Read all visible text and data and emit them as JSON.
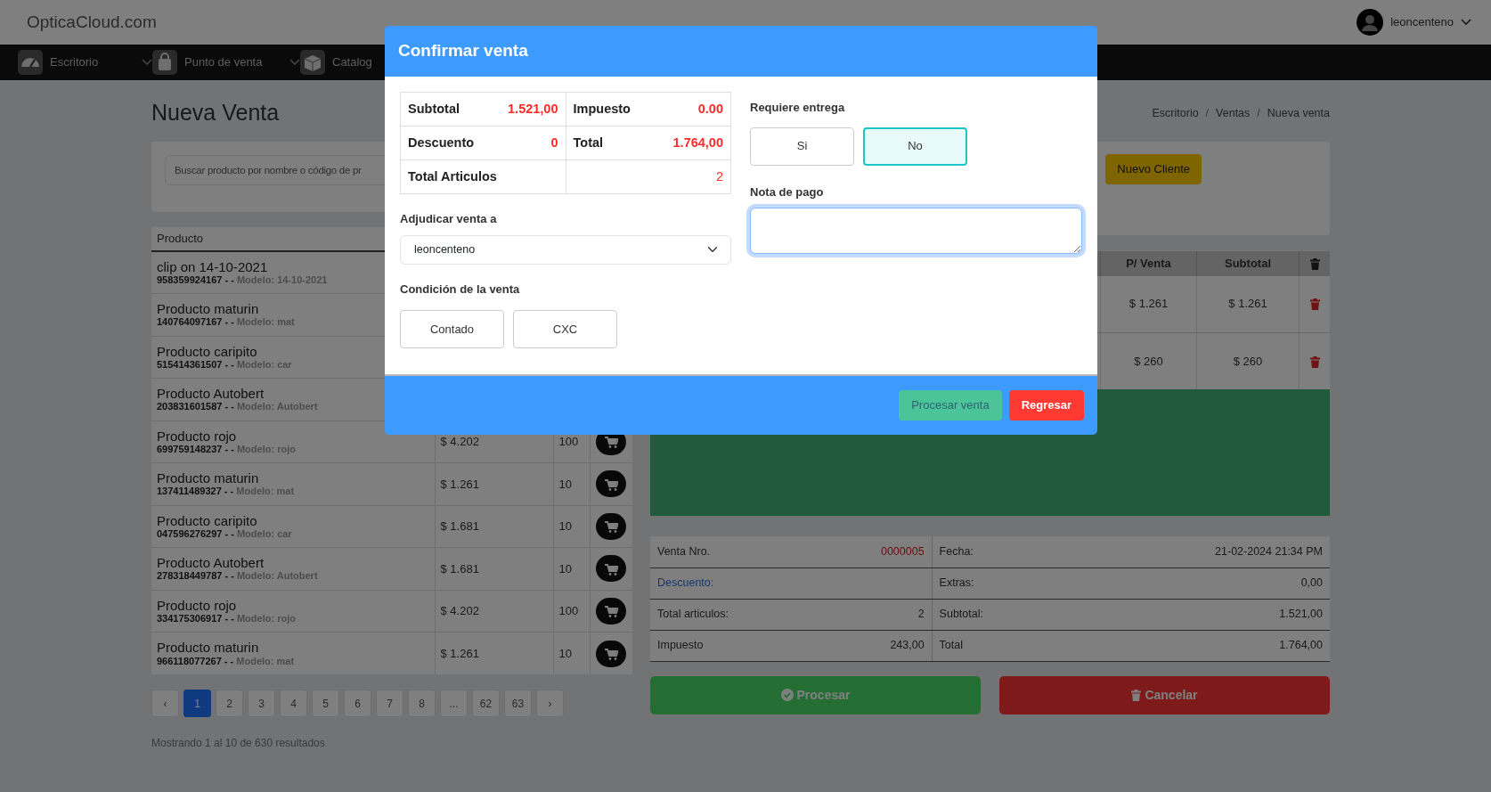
{
  "header": {
    "logo": "OpticaCloud.com",
    "user": "leoncenteno"
  },
  "nav": [
    {
      "label": "Escritorio",
      "dropdown": true
    },
    {
      "label": "Punto de venta",
      "dropdown": true
    },
    {
      "label": "Catalog",
      "dropdown": false
    }
  ],
  "page": {
    "title": "Nueva Venta",
    "breadcrumb": [
      {
        "label": "Escritorio",
        "separator": "/"
      },
      {
        "label": "Ventas",
        "separator": "/"
      },
      {
        "label": "Nueva venta"
      }
    ]
  },
  "search": {
    "placeholder": "Buscar producto por nombre o código de pr"
  },
  "new_client_button": "Nuevo Cliente",
  "products": {
    "columns": [
      "Producto"
    ],
    "rows": [
      {
        "name": "clip on 14-10-2021",
        "code": "958359924167 - -",
        "model": "Modelo: 14-10-2021"
      },
      {
        "name": "Producto maturin",
        "code": "140764097167 - -",
        "model": "Modelo: mat"
      },
      {
        "name": "Producto caripito",
        "code": "515414361507 - -",
        "model": "Modelo: car"
      },
      {
        "name": "Producto Autobert",
        "code": "203831601587 - -",
        "model": "Modelo: Autobert"
      },
      {
        "name": "Producto rojo",
        "code": "699759148237 - -",
        "model": "Modelo: rojo",
        "price": "$ 4.202",
        "stock": "100"
      },
      {
        "name": "Producto maturin",
        "code": "137411489327 - -",
        "model": "Modelo: mat",
        "price": "$ 1.261",
        "stock": "10"
      },
      {
        "name": "Producto caripito",
        "code": "047596276297 - -",
        "model": "Modelo: car",
        "price": "$ 1.681",
        "stock": "10"
      },
      {
        "name": "Producto Autobert",
        "code": "278318449787 - -",
        "model": "Modelo: Autobert",
        "price": "$ 1.681",
        "stock": "10"
      },
      {
        "name": "Producto rojo",
        "code": "334175306917 - -",
        "model": "Modelo: rojo",
        "price": "$ 4.202",
        "stock": "100"
      },
      {
        "name": "Producto maturin",
        "code": "966118077267 - -",
        "model": "Modelo: mat",
        "price": "$ 1.261",
        "stock": "10"
      }
    ]
  },
  "pagination": {
    "pages": [
      {
        "label": "‹",
        "selected": false
      },
      {
        "label": "1",
        "selected": true
      },
      {
        "label": "2",
        "selected": false
      },
      {
        "label": "3",
        "selected": false
      },
      {
        "label": "4",
        "selected": false
      },
      {
        "label": "5",
        "selected": false
      },
      {
        "label": "6",
        "selected": false
      },
      {
        "label": "7",
        "selected": false
      },
      {
        "label": "8",
        "selected": false
      },
      {
        "label": "...",
        "selected": false
      },
      {
        "label": "62",
        "selected": false
      },
      {
        "label": "63",
        "selected": false
      },
      {
        "label": "›",
        "selected": false
      }
    ],
    "summary": "Mostrando 1 al 10 de 630 resultados"
  },
  "cart": {
    "columns": [
      "P/ Venta",
      "Subtotal"
    ],
    "rows": [
      {
        "price": "$ 1.261",
        "subtotal": "$ 1.261"
      },
      {
        "price": "$ 260",
        "subtotal": "$ 260"
      }
    ]
  },
  "summary": {
    "rows": [
      [
        {
          "label": "Venta Nro.",
          "value": "0000005",
          "kind": "code"
        },
        {
          "label": "Fecha:",
          "value": "21-02-2024 21:34 PM",
          "kind": "plain"
        }
      ],
      [
        {
          "label": "Descuento:",
          "kind": "link"
        },
        {
          "label": "Extras:",
          "value": "0,00",
          "kind": "plain"
        }
      ],
      [
        {
          "label": "Total articulos:",
          "value": "2",
          "kind": "plain"
        },
        {
          "label": "Subtotal:",
          "value": "1.521,00",
          "kind": "plain"
        }
      ],
      [
        {
          "label": "Impuesto",
          "value": "243,00",
          "kind": "plain"
        },
        {
          "label": "Total",
          "value": "1.764,00",
          "kind": "plain"
        }
      ]
    ]
  },
  "actions": [
    {
      "label": "Procesar",
      "kind": "process"
    },
    {
      "label": "Cancelar",
      "kind": "cancel"
    }
  ],
  "modal": {
    "title": "Confirmar venta",
    "totals": [
      [
        {
          "label": "Subtotal",
          "value": "1.521,00",
          "kind": "amount"
        },
        {
          "label": "Impuesto",
          "value": "0.00",
          "kind": "amount"
        }
      ],
      [
        {
          "label": "Descuento",
          "value": "0",
          "kind": "amount"
        },
        {
          "label": "Total",
          "value": "1.764,00",
          "kind": "amount"
        }
      ],
      [
        {
          "label": "Total Articulos"
        },
        {
          "value": "2",
          "kind": "count"
        }
      ]
    ],
    "assign": {
      "label": "Adjudicar venta a",
      "value": "leoncenteno"
    },
    "condition": {
      "label": "Condición de la venta",
      "options": [
        {
          "label": "Contado",
          "selected": false
        },
        {
          "label": "CXC",
          "selected": false
        }
      ]
    },
    "delivery": {
      "label": "Requiere entrega",
      "options": [
        {
          "label": "Si",
          "selected": false
        },
        {
          "label": "No",
          "selected": true
        }
      ]
    },
    "note": {
      "label": "Nota de pago",
      "focused": true
    },
    "buttons": [
      {
        "label": "Procesar venta",
        "kind": "process"
      },
      {
        "label": "Regresar",
        "kind": "back"
      }
    ]
  }
}
